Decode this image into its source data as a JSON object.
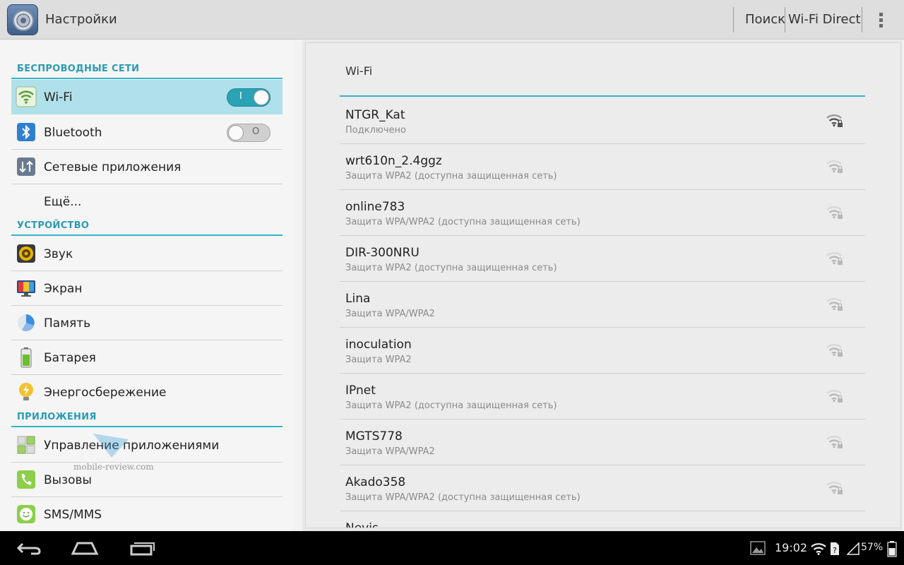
{
  "actionbar": {
    "title": "Настройки",
    "search_label": "Поиск",
    "wifi_direct_label": "Wi-Fi Direct"
  },
  "sidebar": {
    "sections": [
      {
        "header": "БЕСПРОВОДНЫЕ СЕТИ"
      },
      {
        "header": "УСТРОЙСТВО"
      },
      {
        "header": "ПРИЛОЖЕНИЯ"
      }
    ],
    "items": [
      {
        "label": "Wi-Fi",
        "icon": "wifi-icon",
        "toggle": "on",
        "toggle_glyph": "I"
      },
      {
        "label": "Bluetooth",
        "icon": "bluetooth-icon",
        "toggle": "off",
        "toggle_glyph": "O"
      },
      {
        "label": "Сетевые приложения",
        "icon": "network-apps-icon"
      },
      {
        "label": "Ещё..."
      },
      {
        "label": "Звук",
        "icon": "speaker-icon"
      },
      {
        "label": "Экран",
        "icon": "display-icon"
      },
      {
        "label": "Память",
        "icon": "storage-pie-icon"
      },
      {
        "label": "Батарея",
        "icon": "battery-icon"
      },
      {
        "label": "Энергосбережение",
        "icon": "power-saving-bulb-icon"
      },
      {
        "label": "Управление приложениями",
        "icon": "app-manager-icon"
      },
      {
        "label": "Вызовы",
        "icon": "phone-icon"
      },
      {
        "label": "SMS/MMS",
        "icon": "sms-icon"
      }
    ]
  },
  "watermark": "mobile-review.com",
  "wifi_panel": {
    "title": "Wi-Fi",
    "networks": [
      {
        "ssid": "NTGR_Kat",
        "status": "Подключено"
      },
      {
        "ssid": "wrt610n_2.4ggz",
        "status": "Защита WPA2 (доступна защищенная сеть)"
      },
      {
        "ssid": "online783",
        "status": "Защита WPA/WPA2 (доступна защищенная сеть)"
      },
      {
        "ssid": "DIR-300NRU",
        "status": "Защита WPA2 (доступна защищенная сеть)"
      },
      {
        "ssid": "Lina",
        "status": "Защита WPA/WPA2"
      },
      {
        "ssid": "inoculation",
        "status": "Защита WPA2"
      },
      {
        "ssid": "IPnet",
        "status": "Защита WPA2 (доступна защищенная сеть)"
      },
      {
        "ssid": "MGTS778",
        "status": "Защита WPA/WPA2"
      },
      {
        "ssid": "Akado358",
        "status": "Защита WPA/WPA2 (доступна защищенная сеть)"
      },
      {
        "ssid": "Nevis",
        "status": ""
      }
    ]
  },
  "statusbar": {
    "time": "19:02",
    "battery": "57%"
  },
  "colors": {
    "accent": "#33b5c9",
    "selected_row": "#b0e0ea",
    "toggle_on": "#2aa4b4"
  }
}
